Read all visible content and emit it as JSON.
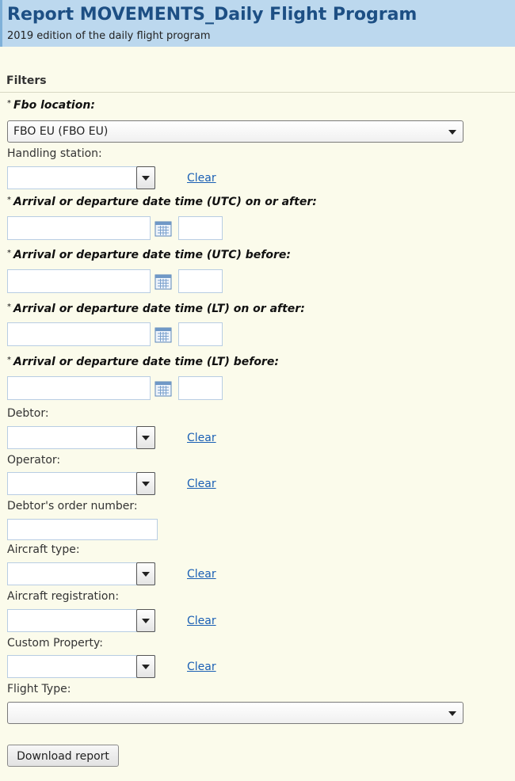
{
  "header": {
    "title": "Report MOVEMENTS_Daily Flight Program",
    "subtitle": "2019 edition of the daily flight program"
  },
  "filters": {
    "section_title": "Filters",
    "required_marker": "*",
    "fbo_location": {
      "label": "Fbo location:",
      "value": "FBO EU (FBO EU)"
    },
    "handling_station": {
      "label": "Handling station:",
      "value": "",
      "clear": "Clear"
    },
    "utc_on_or_after": {
      "label": "Arrival or departure date time (UTC) on or after:",
      "date": "",
      "time": ""
    },
    "utc_before": {
      "label": "Arrival or departure date time (UTC) before:",
      "date": "",
      "time": ""
    },
    "lt_on_or_after": {
      "label": "Arrival or departure date time (LT) on or after:",
      "date": "",
      "time": ""
    },
    "lt_before": {
      "label": "Arrival or departure date time (LT) before:",
      "date": "",
      "time": ""
    },
    "debtor": {
      "label": "Debtor:",
      "value": "",
      "clear": "Clear"
    },
    "operator": {
      "label": "Operator:",
      "value": "",
      "clear": "Clear"
    },
    "debtor_order_number": {
      "label": "Debtor's order number:",
      "value": ""
    },
    "aircraft_type": {
      "label": "Aircraft type:",
      "value": "",
      "clear": "Clear"
    },
    "aircraft_registration": {
      "label": "Aircraft registration:",
      "value": "",
      "clear": "Clear"
    },
    "custom_property": {
      "label": "Custom Property:",
      "value": "",
      "clear": "Clear"
    },
    "flight_type": {
      "label": "Flight Type:",
      "value": ""
    }
  },
  "actions": {
    "download_label": "Download report"
  },
  "colors": {
    "header_bg": "#bcd8ee",
    "title": "#1d4f84",
    "link": "#1a5fb4",
    "page_bg": "#fbfbeb"
  },
  "icons": {
    "calendar": "calendar-icon",
    "dropdown": "chevron-down-icon"
  }
}
